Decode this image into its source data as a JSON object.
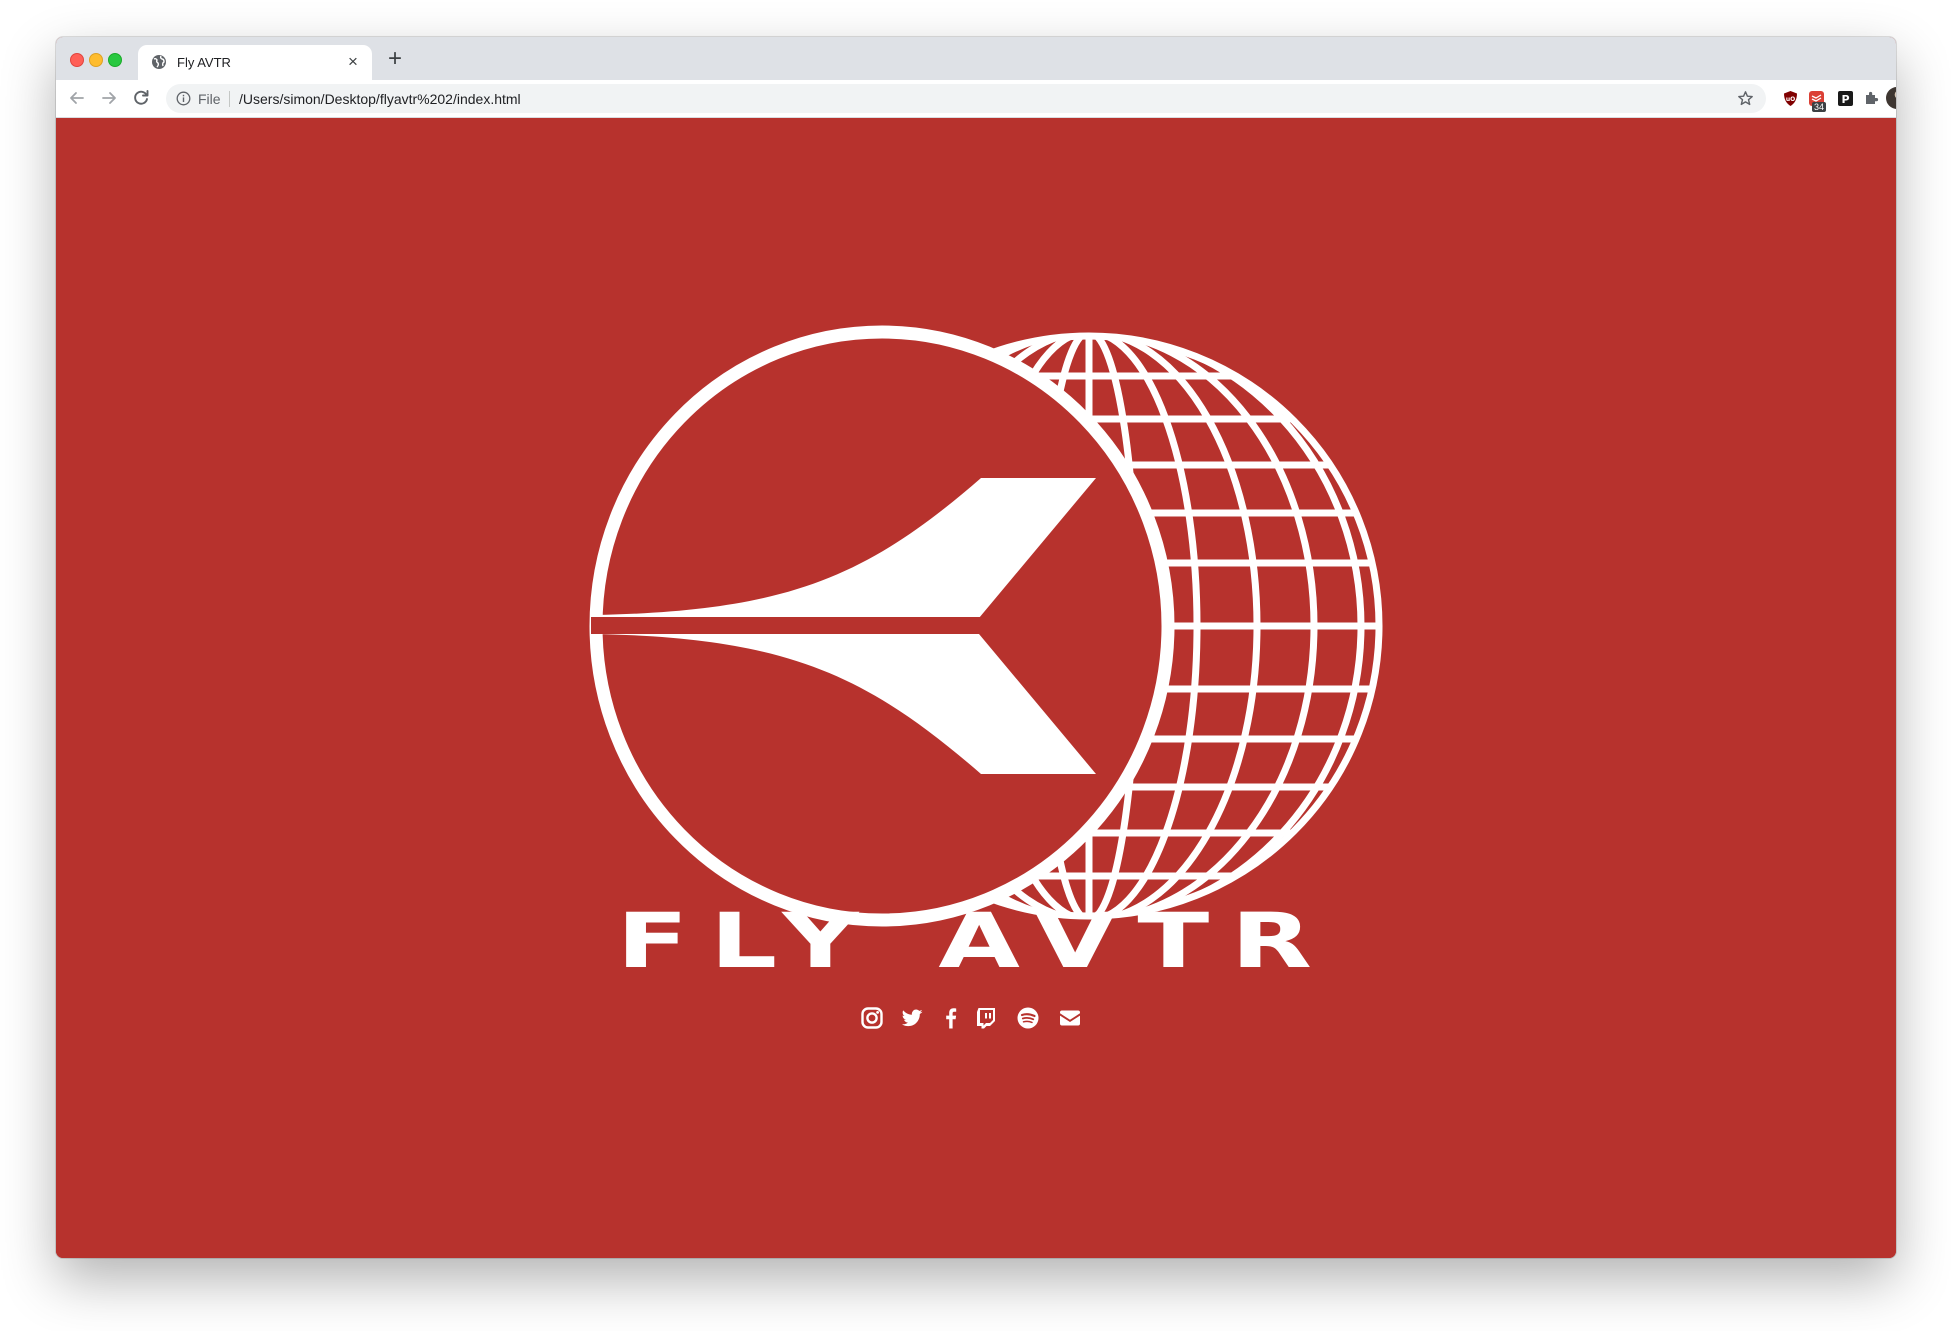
{
  "browser": {
    "tab": {
      "title": "Fly AVTR",
      "favicon": "globe-icon",
      "close_glyph": "×"
    },
    "new_tab_glyph": "+",
    "address": {
      "scheme": "File",
      "url": "/Users/simon/Desktop/flyavtr%202/index.html"
    },
    "extensions": [
      {
        "name": "ublock-icon"
      },
      {
        "name": "todoist-icon",
        "badge": "34"
      },
      {
        "name": "pocket-icon"
      },
      {
        "name": "extensions-puzzle-icon"
      }
    ]
  },
  "page": {
    "background": "#b7322d",
    "foreground": "#ffffff",
    "brand_name": "FLY AVTR",
    "social_links": [
      {
        "name": "instagram-icon"
      },
      {
        "name": "twitter-icon"
      },
      {
        "name": "facebook-icon"
      },
      {
        "name": "twitch-icon"
      },
      {
        "name": "spotify-icon"
      },
      {
        "name": "email-icon"
      }
    ]
  }
}
